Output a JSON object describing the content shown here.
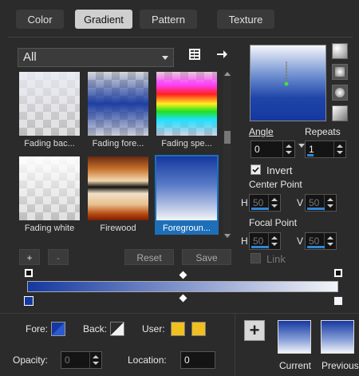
{
  "tabs": [
    {
      "label": "Color",
      "active": false
    },
    {
      "label": "Gradient",
      "active": true
    },
    {
      "label": "Pattern",
      "active": false
    },
    {
      "label": "Texture",
      "active": false
    }
  ],
  "library": {
    "category": "All",
    "items": [
      {
        "label": "Fading bac..."
      },
      {
        "label": "Fading fore..."
      },
      {
        "label": "Fading spe..."
      },
      {
        "label": "Fading white"
      },
      {
        "label": "Firewood"
      },
      {
        "label": "Foregroun..."
      }
    ],
    "add_label": "+",
    "remove_label": "-",
    "reset_label": "Reset",
    "save_label": "Save"
  },
  "settings": {
    "angle_label": "Angle",
    "angle_value": "0",
    "repeats_label": "Repeats",
    "repeats_value": "1",
    "invert_label": "Invert",
    "invert_checked": true,
    "center_point_label": "Center Point",
    "center_h_label": "H",
    "center_h_value": "50",
    "center_v_label": "V",
    "center_v_value": "50",
    "focal_point_label": "Focal Point",
    "focal_h_label": "H",
    "focal_h_value": "50",
    "focal_v_label": "V",
    "focal_v_value": "50",
    "link_label": "Link"
  },
  "editor": {
    "fore_label": "Fore:",
    "back_label": "Back:",
    "user_label": "User:",
    "user_color": "#f0c020",
    "opacity_label": "Opacity:",
    "opacity_value": "0",
    "location_label": "Location:",
    "location_value": "0",
    "add_button": "+",
    "current_label": "Current",
    "previous_label": "Previous"
  },
  "colors": {
    "accent": "#1e6fb8",
    "gradient_blue": "#1538a0"
  }
}
